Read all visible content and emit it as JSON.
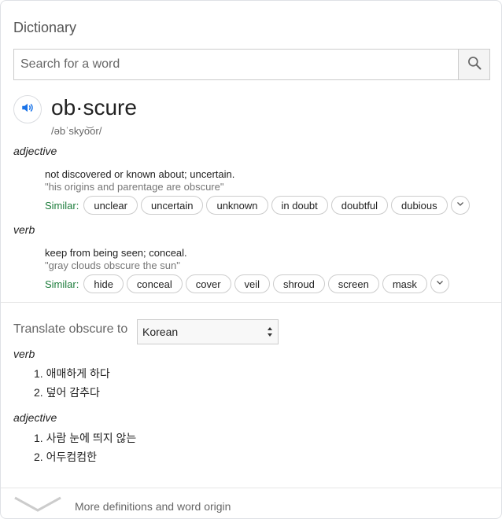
{
  "header": {
    "title": "Dictionary"
  },
  "search": {
    "placeholder": "Search for a word",
    "button_icon": "search-icon"
  },
  "entry": {
    "headword": "ob·scure",
    "phonetic": "/əbˈskyo͝or/",
    "speaker_icon": "speaker-icon",
    "senses": [
      {
        "pos": "adjective",
        "definition": "not discovered or known about; uncertain.",
        "example": "\"his origins and parentage are obscure\"",
        "similar_label": "Similar:",
        "similar": [
          "unclear",
          "uncertain",
          "unknown",
          "in doubt",
          "doubtful",
          "dubious"
        ]
      },
      {
        "pos": "verb",
        "definition": "keep from being seen; conceal.",
        "example": "\"gray clouds obscure the sun\"",
        "similar_label": "Similar:",
        "similar": [
          "hide",
          "conceal",
          "cover",
          "veil",
          "shroud",
          "screen",
          "mask"
        ]
      }
    ]
  },
  "translate": {
    "label": "Translate obscure to",
    "selected_language": "Korean",
    "groups": [
      {
        "pos": "verb",
        "items": [
          "1. 애매하게 하다",
          "2. 덮어 감추다"
        ]
      },
      {
        "pos": "adjective",
        "items": [
          "1. 사람 눈에 띄지 않는",
          "2. 어두컴컴한"
        ]
      }
    ]
  },
  "footer": {
    "more_label": "More definitions and word origin"
  },
  "colors": {
    "accent_blue": "#1a73e8",
    "similar_green": "#1e7d3c",
    "border": "#dfe1e5"
  }
}
